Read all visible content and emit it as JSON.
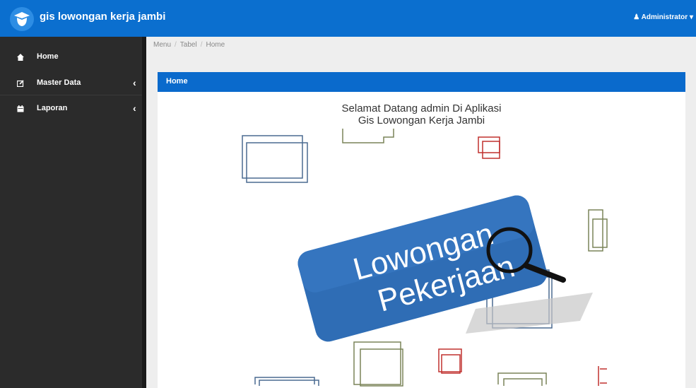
{
  "app": {
    "title": "gis lowongan kerja jambi",
    "user": "Administrator"
  },
  "sidebar": {
    "items": [
      {
        "label": "Home",
        "icon": "home-icon",
        "has_submenu": false
      },
      {
        "label": "Master Data",
        "icon": "edit-icon",
        "has_submenu": true
      },
      {
        "label": "Laporan",
        "icon": "calendar-icon",
        "has_submenu": true
      }
    ]
  },
  "breadcrumb": [
    "Menu",
    "Tabel",
    "Home"
  ],
  "panel": {
    "title": "Home",
    "welcome_line1": "Selamat Datang admin Di Aplikasi",
    "welcome_line2": "Gis Lowongan Kerja Jambi"
  },
  "banner": {
    "line1": "Lowongan",
    "line2": "Pekerjaan"
  },
  "colors": {
    "topbar": "#0b6fcf",
    "sidebar": "#2b2b2b",
    "panel_header": "#0a6acc",
    "banner_blue": "#2f6db5"
  }
}
